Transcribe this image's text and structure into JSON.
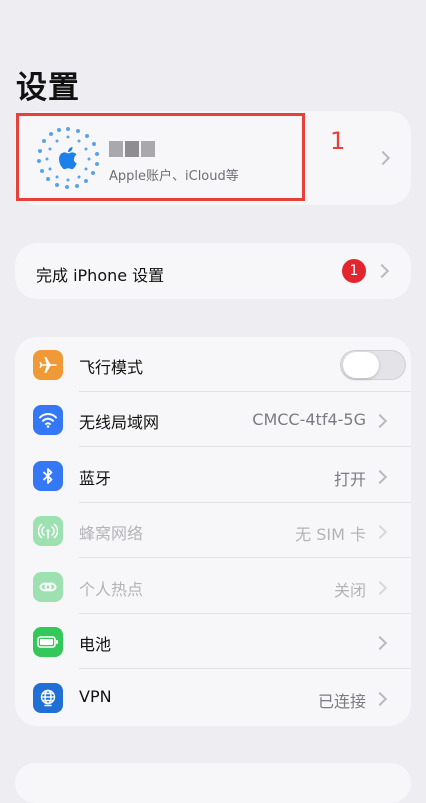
{
  "page": {
    "title": "设置"
  },
  "annotation": {
    "number": "1",
    "color": "#e8413a"
  },
  "account": {
    "subtitle": "Apple账户、iCloud等",
    "icon": "apple-logo-icon"
  },
  "setup": {
    "label": "完成 iPhone 设置",
    "badge": "1"
  },
  "settings": [
    {
      "key": "airplane",
      "label": "飞行模式",
      "value": "",
      "icon": "airplane-icon",
      "color": "#f09a37",
      "toggle": true,
      "toggle_on": false
    },
    {
      "key": "wifi",
      "label": "无线局域网",
      "value": "CMCC-4tf4-5G",
      "icon": "wifi-icon",
      "color": "#3478f6"
    },
    {
      "key": "bluetooth",
      "label": "蓝牙",
      "value": "打开",
      "icon": "bluetooth-icon",
      "color": "#3478f6"
    },
    {
      "key": "cellular",
      "label": "蜂窝网络",
      "value": "无 SIM 卡",
      "icon": "antenna-icon",
      "color": "#34c759",
      "disabled": true
    },
    {
      "key": "hotspot",
      "label": "个人热点",
      "value": "关闭",
      "icon": "link-icon",
      "color": "#34c759",
      "disabled": true
    },
    {
      "key": "battery",
      "label": "电池",
      "value": "",
      "icon": "battery-icon",
      "color": "#34c759"
    },
    {
      "key": "vpn",
      "label": "VPN",
      "value": "已连接",
      "icon": "globe-icon",
      "color": "#1f6fd6"
    }
  ]
}
